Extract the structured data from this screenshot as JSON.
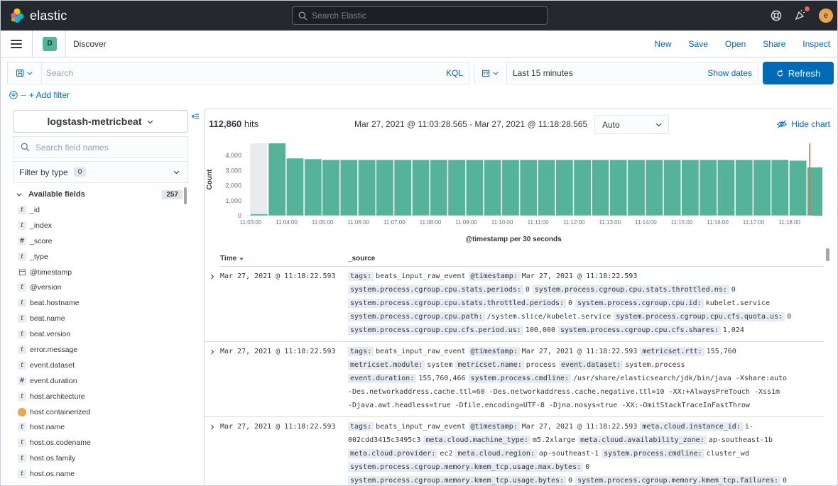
{
  "header": {
    "brand": "elastic",
    "search_placeholder": "Search Elastic",
    "user_initial": "e"
  },
  "appbar": {
    "app_badge": "D",
    "app_title": "Discover",
    "nav": [
      "New",
      "Save",
      "Open",
      "Share",
      "Inspect"
    ]
  },
  "querybar": {
    "search_placeholder": "Search",
    "language": "KQL",
    "date_range": "Last 15 minutes",
    "show_dates": "Show dates",
    "refresh": "Refresh",
    "add_filter": "+ Add filter"
  },
  "sidebar": {
    "index_pattern": "logstash-metricbeat",
    "field_search_placeholder": "Search field names",
    "filter_by_type": "Filter by type",
    "filter_count": "0",
    "available_fields_label": "Available fields",
    "available_fields_count": "257",
    "fields": [
      {
        "type": "t",
        "name": "_id"
      },
      {
        "type": "t",
        "name": "_index"
      },
      {
        "type": "#",
        "name": "_score"
      },
      {
        "type": "t",
        "name": "_type"
      },
      {
        "type": "date",
        "name": "@timestamp"
      },
      {
        "type": "t",
        "name": "@version"
      },
      {
        "type": "t",
        "name": "beat.hostname"
      },
      {
        "type": "t",
        "name": "beat.name"
      },
      {
        "type": "t",
        "name": "beat.version"
      },
      {
        "type": "t",
        "name": "error.message"
      },
      {
        "type": "t",
        "name": "event.dataset"
      },
      {
        "type": "#",
        "name": "event.duration"
      },
      {
        "type": "t",
        "name": "host.architecture"
      },
      {
        "type": "geo",
        "name": "host.containerized"
      },
      {
        "type": "t",
        "name": "host.name"
      },
      {
        "type": "t",
        "name": "host.os.codename"
      },
      {
        "type": "t",
        "name": "host.os.family"
      },
      {
        "type": "t",
        "name": "host.os.name"
      }
    ]
  },
  "results": {
    "hits_count": "112,860",
    "hits_label": "hits",
    "time_range": "Mar 27, 2021 @ 11:03:28.565 - Mar 27, 2021 @ 11:18:28.565",
    "interval": "Auto",
    "hide_chart": "Hide chart",
    "columns": [
      "Time",
      "_source"
    ]
  },
  "chart_data": {
    "type": "bar",
    "ylabel": "Count",
    "xlabel": "@timestamp per 30 seconds",
    "ylim": [
      0,
      4800
    ],
    "yticks": [
      0,
      1000,
      2000,
      3000,
      4000
    ],
    "ytick_labels": [
      "0",
      "1,000",
      "2,000",
      "3,000",
      "4,000"
    ],
    "xtick_labels": [
      "11:03:00",
      "11:04:00",
      "11:05:00",
      "11:06:00",
      "11:07:00",
      "11:08:00",
      "11:09:00",
      "11:10:00",
      "11:11:00",
      "11:12:00",
      "11:13:00",
      "11:14:00",
      "11:15:00",
      "11:16:00",
      "11:17:00",
      "11:18:00"
    ],
    "values": [
      100,
      4800,
      3800,
      3750,
      3700,
      3700,
      3700,
      3700,
      3700,
      3700,
      3700,
      3700,
      3700,
      3700,
      3700,
      3700,
      3700,
      3700,
      3700,
      3700,
      3700,
      3700,
      3700,
      3700,
      3700,
      3700,
      3700,
      3700,
      3700,
      3700,
      3650,
      3200
    ],
    "bar_color": "#54b399"
  },
  "documents": [
    {
      "time": "Mar 27, 2021 @ 11:18:22.593",
      "lines": [
        [
          {
            "k": "tags:",
            "v": "beats_input_raw_event"
          },
          {
            "k": "@timestamp:",
            "v": "Mar 27, 2021 @ 11:18:22.593"
          }
        ],
        [
          {
            "k": "system.process.cgroup.cpu.stats.periods:",
            "v": "0"
          },
          {
            "k": "system.process.cgroup.cpu.stats.throttled.ns:",
            "v": "0"
          }
        ],
        [
          {
            "k": "system.process.cgroup.cpu.stats.throttled.periods:",
            "v": "0"
          },
          {
            "k": "system.process.cgroup.cpu.id:",
            "v": "kubelet.service"
          }
        ],
        [
          {
            "k": "system.process.cgroup.cpu.path:",
            "v": "/system.slice/kubelet.service"
          },
          {
            "k": "system.process.cgroup.cpu.cfs.quota.us:",
            "v": "0"
          }
        ],
        [
          {
            "k": "system.process.cgroup.cpu.cfs.period.us:",
            "v": "100,000"
          },
          {
            "k": "system.process.cgroup.cpu.cfs.shares:",
            "v": "1,024"
          }
        ]
      ]
    },
    {
      "time": "Mar 27, 2021 @ 11:18:22.593",
      "lines": [
        [
          {
            "k": "tags:",
            "v": "beats_input_raw_event"
          },
          {
            "k": "@timestamp:",
            "v": "Mar 27, 2021 @ 11:18:22.593"
          },
          {
            "k": "metricset.rtt:",
            "v": "155,760"
          }
        ],
        [
          {
            "k": "metricset.module:",
            "v": "system"
          },
          {
            "k": "metricset.name:",
            "v": "process"
          },
          {
            "k": "event.dataset:",
            "v": "system.process"
          }
        ],
        [
          {
            "k": "event.duration:",
            "v": "155,760,466"
          },
          {
            "k": "system.process.cmdline:",
            "v": "/usr/share/elasticsearch/jdk/bin/java -Xshare:auto"
          }
        ],
        [
          {
            "k": "",
            "v": "-Des.networkaddress.cache.ttl=60 -Des.networkaddress.cache.negative.ttl=10 -XX:+AlwaysPreTouch -Xss1m"
          }
        ],
        [
          {
            "k": "",
            "v": "-Djava.awt.headless=true -Dfile.encoding=UTF-8 -Djna.nosys=true -XX:-OmitStackTraceInFastThrow"
          }
        ]
      ]
    },
    {
      "time": "Mar 27, 2021 @ 11:18:22.593",
      "lines": [
        [
          {
            "k": "tags:",
            "v": "beats_input_raw_event"
          },
          {
            "k": "@timestamp:",
            "v": "Mar 27, 2021 @ 11:18:22.593"
          },
          {
            "k": "meta.cloud.instance_id:",
            "v": "i-"
          }
        ],
        [
          {
            "k": "",
            "v": "002cdd3415c3495c3"
          },
          {
            "k": "meta.cloud.machine_type:",
            "v": "m5.2xlarge"
          },
          {
            "k": "meta.cloud.availability_zone:",
            "v": "ap-southeast-1b"
          }
        ],
        [
          {
            "k": "meta.cloud.provider:",
            "v": "ec2"
          },
          {
            "k": "meta.cloud.region:",
            "v": "ap-southeast-1"
          },
          {
            "k": "system.process.cmdline:",
            "v": "cluster_wd"
          }
        ],
        [
          {
            "k": "system.process.cgroup.memory.kmem_tcp.usage.max.bytes:",
            "v": "0"
          }
        ],
        [
          {
            "k": "system.process.cgroup.memory.kmem_tcp.usage.bytes:",
            "v": "0"
          },
          {
            "k": "system.process.cgroup.memory.kmem_tcp.failures:",
            "v": "0"
          }
        ]
      ]
    }
  ]
}
